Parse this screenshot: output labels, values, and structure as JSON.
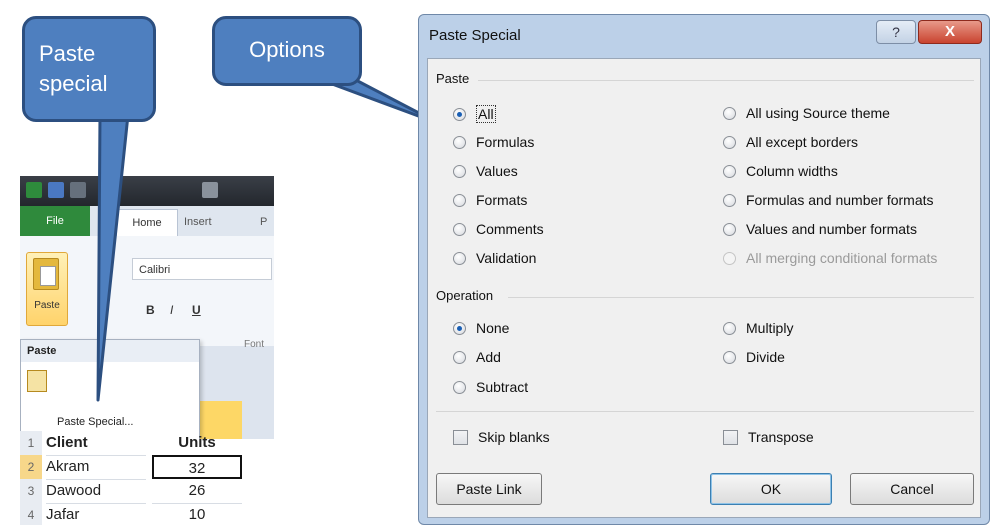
{
  "callouts": {
    "paste_special": "Paste special",
    "options": "Options"
  },
  "excel": {
    "tabs": {
      "file": "File",
      "home": "Home",
      "insert": "Insert",
      "page": "P"
    },
    "paste_button_label": "Paste",
    "font_name": "Calibri",
    "format_buttons": [
      "B",
      "I",
      "U"
    ],
    "font_group_label": "Font",
    "paste_menu": {
      "title": "Paste",
      "item": "Paste Special..."
    },
    "grid": {
      "header": {
        "row": "1",
        "client": "Client",
        "units": "Units"
      },
      "rows": [
        {
          "num": "2",
          "client": "Akram",
          "units": "32"
        },
        {
          "num": "3",
          "client": "Dawood",
          "units": "26"
        },
        {
          "num": "4",
          "client": "Jafar",
          "units": "10"
        }
      ]
    }
  },
  "dialog": {
    "title": "Paste Special",
    "help_label": "?",
    "close_label": "X",
    "paste_group": {
      "title": "Paste",
      "left": [
        {
          "label": "All",
          "selected": true
        },
        {
          "label": "Formulas",
          "selected": false
        },
        {
          "label": "Values",
          "selected": false
        },
        {
          "label": "Formats",
          "selected": false
        },
        {
          "label": "Comments",
          "selected": false
        },
        {
          "label": "Validation",
          "selected": false
        }
      ],
      "right": [
        {
          "label": "All using Source theme",
          "selected": false
        },
        {
          "label": "All except borders",
          "selected": false
        },
        {
          "label": "Column widths",
          "selected": false
        },
        {
          "label": "Formulas and number formats",
          "selected": false
        },
        {
          "label": "Values and number formats",
          "selected": false
        },
        {
          "label": "All merging conditional formats",
          "selected": false,
          "disabled": true
        }
      ]
    },
    "operation_group": {
      "title": "Operation",
      "left": [
        {
          "label": "None",
          "selected": true
        },
        {
          "label": "Add",
          "selected": false
        },
        {
          "label": "Subtract",
          "selected": false
        }
      ],
      "right": [
        {
          "label": "Multiply",
          "selected": false
        },
        {
          "label": "Divide",
          "selected": false
        }
      ]
    },
    "checkboxes": {
      "skip_blanks": {
        "label": "Skip blanks",
        "checked": false
      },
      "transpose": {
        "label": "Transpose",
        "checked": false
      }
    },
    "buttons": {
      "paste_link": "Paste Link",
      "ok": "OK",
      "cancel": "Cancel"
    }
  },
  "colors": {
    "callout_fill": "#4e7fbf",
    "dialog_frame": "#bcd0e8",
    "close_button": "#c9432f"
  }
}
